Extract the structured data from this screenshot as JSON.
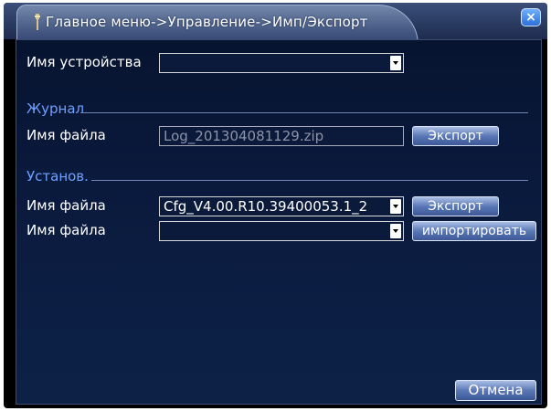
{
  "window": {
    "title": "Главное меню->Управление->Имп/Экспорт",
    "close_glyph": "×"
  },
  "device": {
    "label": "Имя устройства",
    "value": ""
  },
  "log": {
    "section_title": "Журнал",
    "file_label": "Имя файла",
    "file_value": "Log_201304081129.zip",
    "export_label": "Экспорт"
  },
  "config": {
    "section_title": "Установ.",
    "export_file_label": "Имя файла",
    "export_file_value": "Cfg_V4.00.R10.39400053.1_2",
    "export_label": "Экспорт",
    "import_file_label": "Имя файла",
    "import_file_value": "",
    "import_label": "импортировать"
  },
  "footer": {
    "cancel_label": "Отмена"
  },
  "colors": {
    "section_text": "#6fa0ff",
    "panel_bg": "#0a1a3d",
    "button_accent": "#5a78b6"
  },
  "icons": {
    "title": "wrench-icon",
    "close": "close-icon",
    "dropdown": "chevron-down-icon"
  }
}
